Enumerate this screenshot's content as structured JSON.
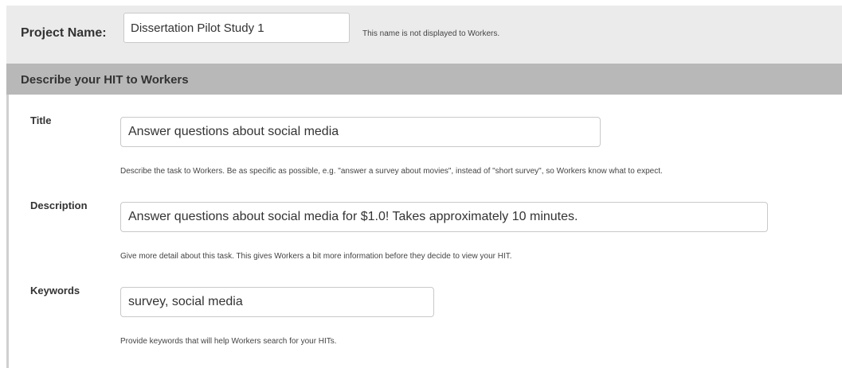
{
  "project": {
    "label": "Project Name:",
    "value": "Dissertation Pilot Study 1",
    "hint": "This name is not displayed to Workers."
  },
  "section": {
    "title": "Describe your HIT to Workers"
  },
  "fields": {
    "title": {
      "label": "Title",
      "value": "Answer questions about social media",
      "hint": "Describe the task to Workers. Be as specific as possible, e.g. \"answer a survey about movies\", instead of \"short survey\", so Workers know what to expect."
    },
    "description": {
      "label": "Description",
      "value": "Answer questions about social media for $1.0! Takes approximately 10 minutes.",
      "hint": "Give more detail about this task. This gives Workers a bit more information before they decide to view your HIT."
    },
    "keywords": {
      "label": "Keywords",
      "value": "survey, social media",
      "hint": "Provide keywords that will help Workers search for your HITs."
    }
  }
}
